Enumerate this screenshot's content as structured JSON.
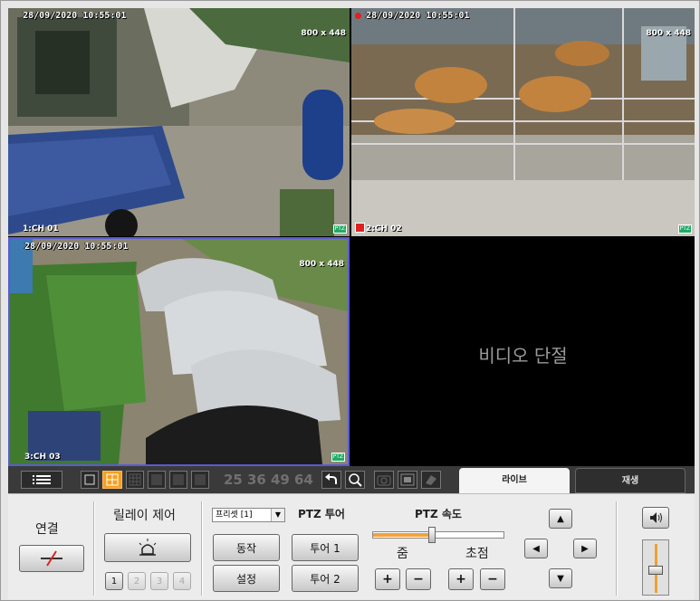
{
  "cameras": [
    {
      "timestamp": "28/09/2020 10:55:01",
      "resolution": "800 x 448",
      "channel": "1:CH 01",
      "ptz": "PTZ",
      "recording": false
    },
    {
      "timestamp": "28/09/2020 10:55:01",
      "resolution": "800 x 448",
      "channel": "2:CH 02",
      "ptz": "PTZ",
      "recording": true
    },
    {
      "timestamp": "28/09/2020 10:55:01",
      "resolution": "800 x 448",
      "channel": "3:CH 03",
      "ptz": "PTZ",
      "recording": false
    },
    {
      "video_lost": "비디오 단절"
    }
  ],
  "toolbar": {
    "layout_numbers": [
      "25",
      "36",
      "49",
      "64"
    ],
    "tabs": {
      "live": "라이브",
      "playback": "재생"
    },
    "active_tab": "live"
  },
  "panel": {
    "connect": {
      "label": "연결"
    },
    "relay": {
      "label": "릴레이 제어",
      "channels": [
        "1",
        "2",
        "3",
        "4"
      ]
    },
    "preset": {
      "selected": "프리셋 [1]",
      "action": "동작",
      "setting": "설정"
    },
    "tour": {
      "label": "PTZ 투어",
      "tour1": "투어 1",
      "tour2": "투어 2"
    },
    "speed": {
      "label": "PTZ 속도",
      "value": 0.45
    },
    "zoom": {
      "label": "줌",
      "plus": "+",
      "minus": "−"
    },
    "focus": {
      "label": "초점",
      "plus": "+",
      "minus": "−"
    },
    "volume": {
      "level": 0.45
    }
  },
  "colors": {
    "accent": "#f0a030",
    "selected_border": "#5a5ad6",
    "rec": "#e02020"
  }
}
